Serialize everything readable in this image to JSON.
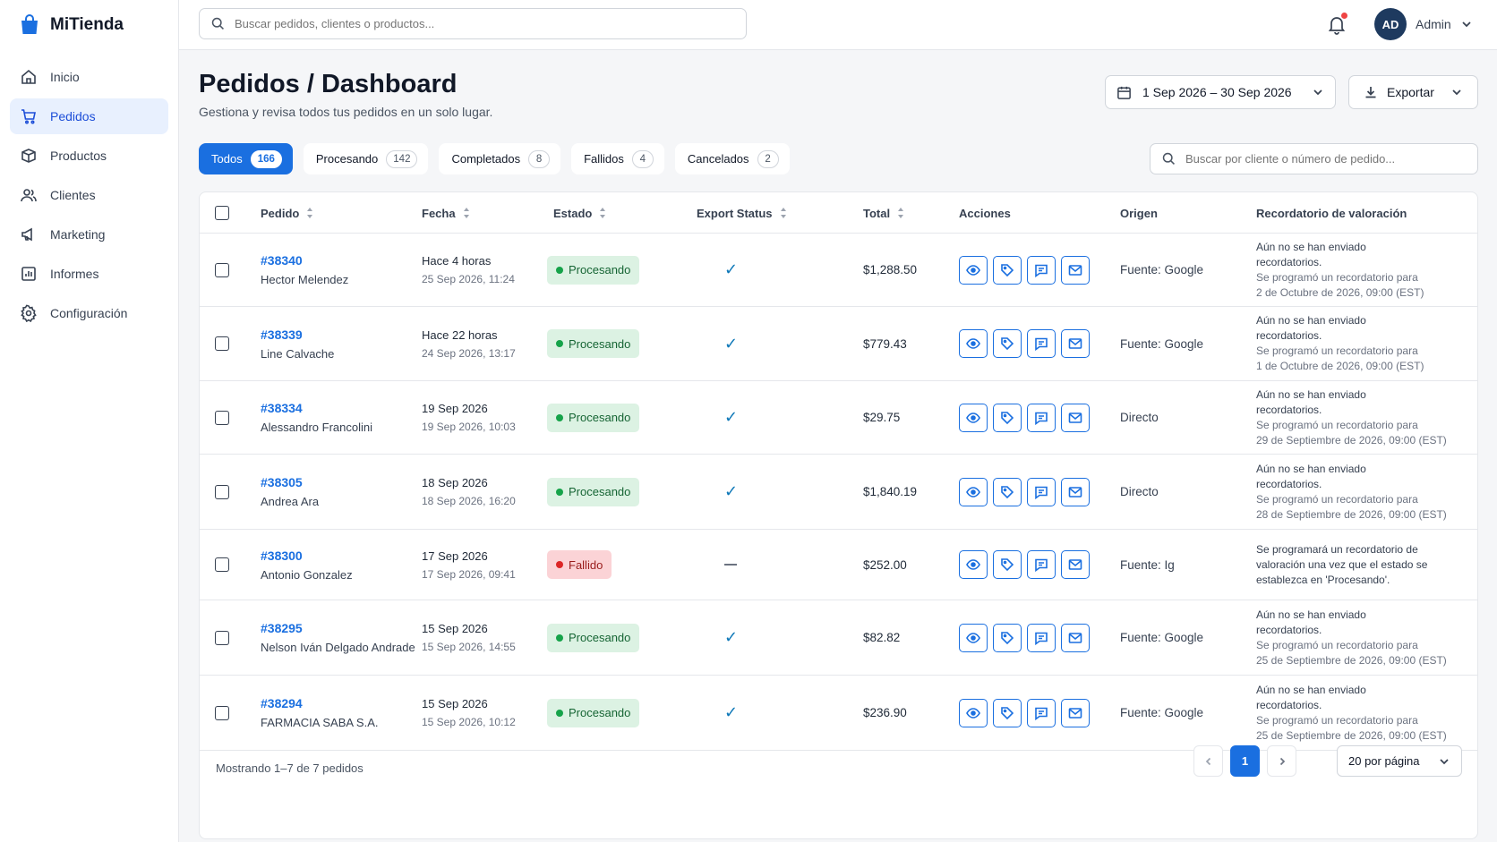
{
  "brand": {
    "name": "MiTienda"
  },
  "topbar": {
    "search_placeholder": "Buscar pedidos, clientes o productos...",
    "user_initials": "AD",
    "user_name": "Admin"
  },
  "sidebar": {
    "items": [
      {
        "label": "Inicio",
        "icon": "home-icon"
      },
      {
        "label": "Pedidos",
        "icon": "cart-icon",
        "active": true
      },
      {
        "label": "Productos",
        "icon": "box-icon"
      },
      {
        "label": "Clientes",
        "icon": "users-icon"
      },
      {
        "label": "Marketing",
        "icon": "megaphone-icon"
      },
      {
        "label": "Informes",
        "icon": "chart-icon"
      },
      {
        "label": "Configuración",
        "icon": "gear-icon"
      }
    ]
  },
  "header": {
    "title": "Pedidos / Dashboard",
    "subtitle": "Gestiona y revisa todos tus pedidos en un solo lugar.",
    "date_range": "1 Sep 2026 – 30 Sep 2026",
    "export_label": "Exportar"
  },
  "tabs": [
    {
      "label": "Todos",
      "count": "166",
      "active": true
    },
    {
      "label": "Procesando",
      "count": "142"
    },
    {
      "label": "Completados",
      "count": "8"
    },
    {
      "label": "Fallidos",
      "count": "4"
    },
    {
      "label": "Cancelados",
      "count": "2"
    }
  ],
  "order_search_placeholder": "Buscar por cliente o número de pedido...",
  "table": {
    "columns": {
      "pedido": "Pedido",
      "fecha": "Fecha",
      "estado": "Estado",
      "export": "Export Status",
      "total": "Total",
      "acciones": "Acciones",
      "origen": "Origen",
      "recordatorio": "Recordatorio de valoración"
    },
    "rows": [
      {
        "id": "#38340",
        "customer": "Hector Melendez",
        "date": "Hace 4 horas",
        "date_full": "25 Sep 2026, 11:24",
        "status": "Procesando",
        "status_type": "proc",
        "export_ok": true,
        "total": "$1,288.50",
        "origin": "Fuente: Google",
        "reminder_lines": [
          "Aún no se han enviado",
          "recordatorios.",
          "Se programó un recordatorio para",
          "2 de Octubre de 2026, 09:00 (EST)"
        ]
      },
      {
        "id": "#38339",
        "customer": "Line Calvache",
        "date": "Hace 22 horas",
        "date_full": "24 Sep 2026, 13:17",
        "status": "Procesando",
        "status_type": "proc",
        "export_ok": true,
        "total": "$779.43",
        "origin": "Fuente: Google",
        "reminder_lines": [
          "Aún no se han enviado",
          "recordatorios.",
          "Se programó un recordatorio para",
          "1 de Octubre de 2026, 09:00 (EST)"
        ]
      },
      {
        "id": "#38334",
        "customer": "Alessandro Francolini",
        "date": "19 Sep 2026",
        "date_full": "19 Sep 2026, 10:03",
        "status": "Procesando",
        "status_type": "proc",
        "export_ok": true,
        "total": "$29.75",
        "origin": "Directo",
        "reminder_lines": [
          "Aún no se han enviado",
          "recordatorios.",
          "Se programó un recordatorio para",
          "29 de Septiembre de 2026, 09:00 (EST)"
        ]
      },
      {
        "id": "#38305",
        "customer": "Andrea Ara",
        "date": "18 Sep 2026",
        "date_full": "18 Sep 2026, 16:20",
        "status": "Procesando",
        "status_type": "proc",
        "export_ok": true,
        "total": "$1,840.19",
        "origin": "Directo",
        "reminder_lines": [
          "Aún no se han enviado",
          "recordatorios.",
          "Se programó un recordatorio para",
          "28 de Septiembre de 2026, 09:00 (EST)"
        ]
      },
      {
        "id": "#38300",
        "customer": "Antonio Gonzalez",
        "date": "17 Sep 2026",
        "date_full": "17 Sep 2026, 09:41",
        "status": "Fallido",
        "status_type": "fail",
        "export_ok": false,
        "total": "$252.00",
        "origin": "Fuente: Ig",
        "reminder_lines": [
          "Se programará un recordatorio de",
          "valoración una vez que el estado se",
          "establezca en 'Procesando'."
        ]
      },
      {
        "id": "#38295",
        "customer": "Nelson Iván Delgado Andrade",
        "date": "15 Sep 2026",
        "date_full": "15 Sep 2026, 14:55",
        "status": "Procesando",
        "status_type": "proc",
        "export_ok": true,
        "total": "$82.82",
        "origin": "Fuente: Google",
        "reminder_lines": [
          "Aún no se han enviado",
          "recordatorios.",
          "Se programó un recordatorio para",
          "25 de Septiembre de 2026, 09:00 (EST)"
        ]
      },
      {
        "id": "#38294",
        "customer": "FARMACIA SABA S.A.",
        "date": "15 Sep 2026",
        "date_full": "15 Sep 2026, 10:12",
        "status": "Procesando",
        "status_type": "proc",
        "export_ok": true,
        "total": "$236.90",
        "origin": "Fuente: Google",
        "reminder_lines": [
          "Aún no se han enviado",
          "recordatorios.",
          "Se programó un recordatorio para",
          "25 de Septiembre de 2026, 09:00 (EST)"
        ]
      }
    ]
  },
  "footer": {
    "showing": "Mostrando 1–7 de 7 pedidos",
    "current_page": "1",
    "per_page": "20 por página"
  },
  "colors": {
    "accent": "#1a6fe0",
    "success_bg": "#dcf2e3",
    "danger_bg": "#fbd3d6",
    "check": "#0e78b8"
  }
}
